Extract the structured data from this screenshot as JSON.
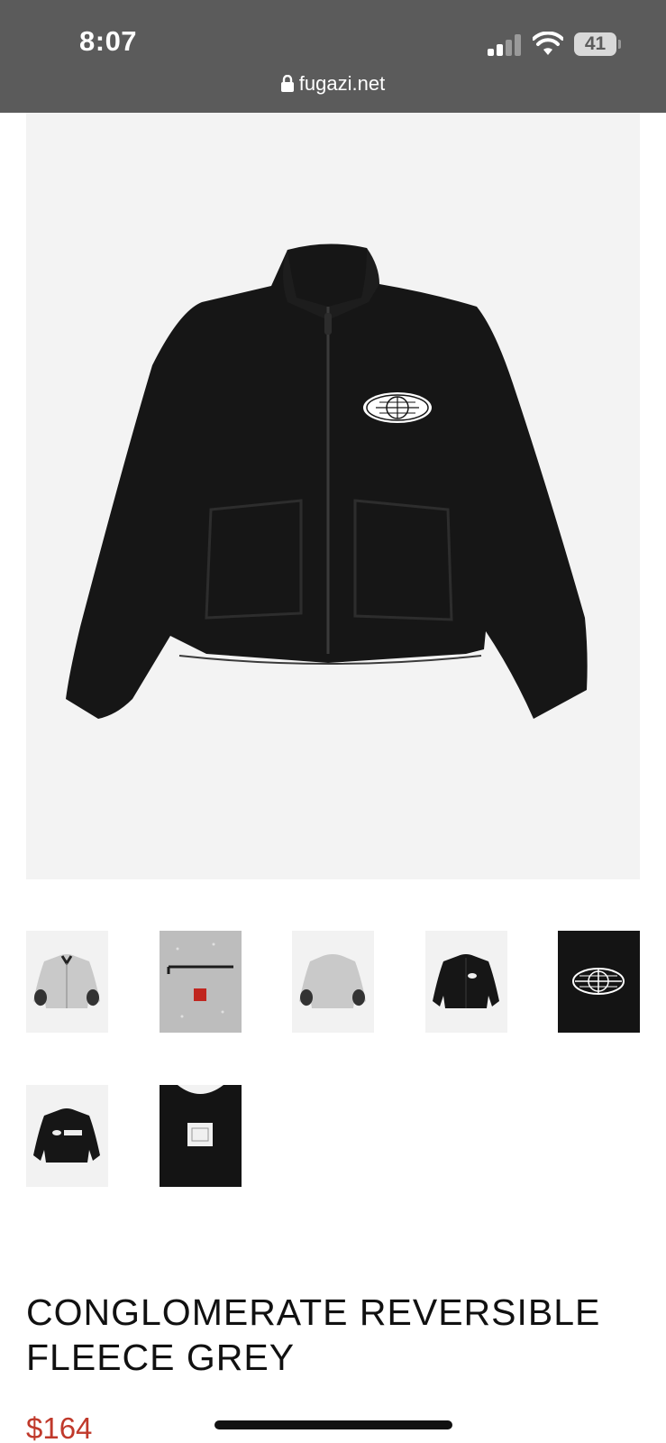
{
  "status_bar": {
    "time": "8:07",
    "battery": "41",
    "url": "fugazi.net"
  },
  "product": {
    "main_image": "black-jacket-front",
    "thumbnails": [
      {
        "name": "grey-fleece-front"
      },
      {
        "name": "fleece-detail-zip-red-tag"
      },
      {
        "name": "grey-fleece-back"
      },
      {
        "name": "black-jacket-front"
      },
      {
        "name": "globe-logo-patch"
      },
      {
        "name": "black-jacket-2008-back"
      },
      {
        "name": "black-jacket-label-closeup"
      }
    ],
    "title": "CONGLOMERATE REVERSIBLE FLEECE GREY",
    "price": "$164"
  },
  "colors": {
    "status_bar": "#5b5b5b",
    "price": "#c0392b",
    "image_bg": "#f3f3f3"
  }
}
